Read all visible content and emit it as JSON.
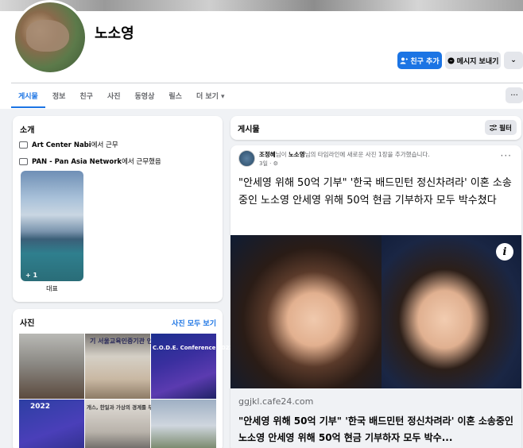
{
  "profile": {
    "name": "노소영",
    "add_friend_label": "친구 추가",
    "message_label": "메시지 보내기",
    "more_label": "⌄"
  },
  "tabs": [
    {
      "label": "게시물",
      "active": true
    },
    {
      "label": "정보"
    },
    {
      "label": "친구"
    },
    {
      "label": "사진"
    },
    {
      "label": "동영상"
    },
    {
      "label": "릴스"
    },
    {
      "label": "더 보기 ▾"
    }
  ],
  "tabs_more": "···",
  "intro": {
    "title": "소개",
    "rows": [
      {
        "bold": "Art Center Nabi",
        "rest": "에서 근무"
      },
      {
        "bold": "PAN - Pan Asia Network",
        "rest": "에서 근무했음"
      }
    ],
    "featured_count": "+ 1",
    "featured_label": "대표"
  },
  "photos": {
    "title": "사진",
    "see_all": "사진 모두 보기",
    "captions": [
      "기 서울교육인증기관 인",
      "C.O.D.E. Conference 2022",
      "2022",
      "개스, 한일과 가상의 경계를 무너뜨리"
    ]
  },
  "posts": {
    "title": "게시물",
    "filter_label": "필터",
    "post": {
      "author": "조정혜",
      "meta_mid": "님이 ",
      "tagged": "노소영",
      "meta_rest": "님의 타임라인에 새로운 사진 1장을 추가했습니다.",
      "time": "3일 · ⚙",
      "dots": "···",
      "text": "\"안세영 위해 50억 기부\" '한국 배드민턴 정신차려라' 이혼 소송중인 노소영 안세영 위해 50억 현금 기부하자 모두 박수쳤다",
      "link_domain": "ggjkl.cafe24.com",
      "link_title": "\"안세영 위해 50억 기부\" '한국 배드민턴 정신차려라' 이혼 소송중인 노소영 안세영 위해 50억 현금 기부하자 모두 박수...",
      "info_glyph": "i"
    }
  },
  "colors": {
    "accent": "#1b74e4",
    "page_bg": "#f0f2f5",
    "card_bg": "#ffffff",
    "secondary_text": "#65676b"
  }
}
